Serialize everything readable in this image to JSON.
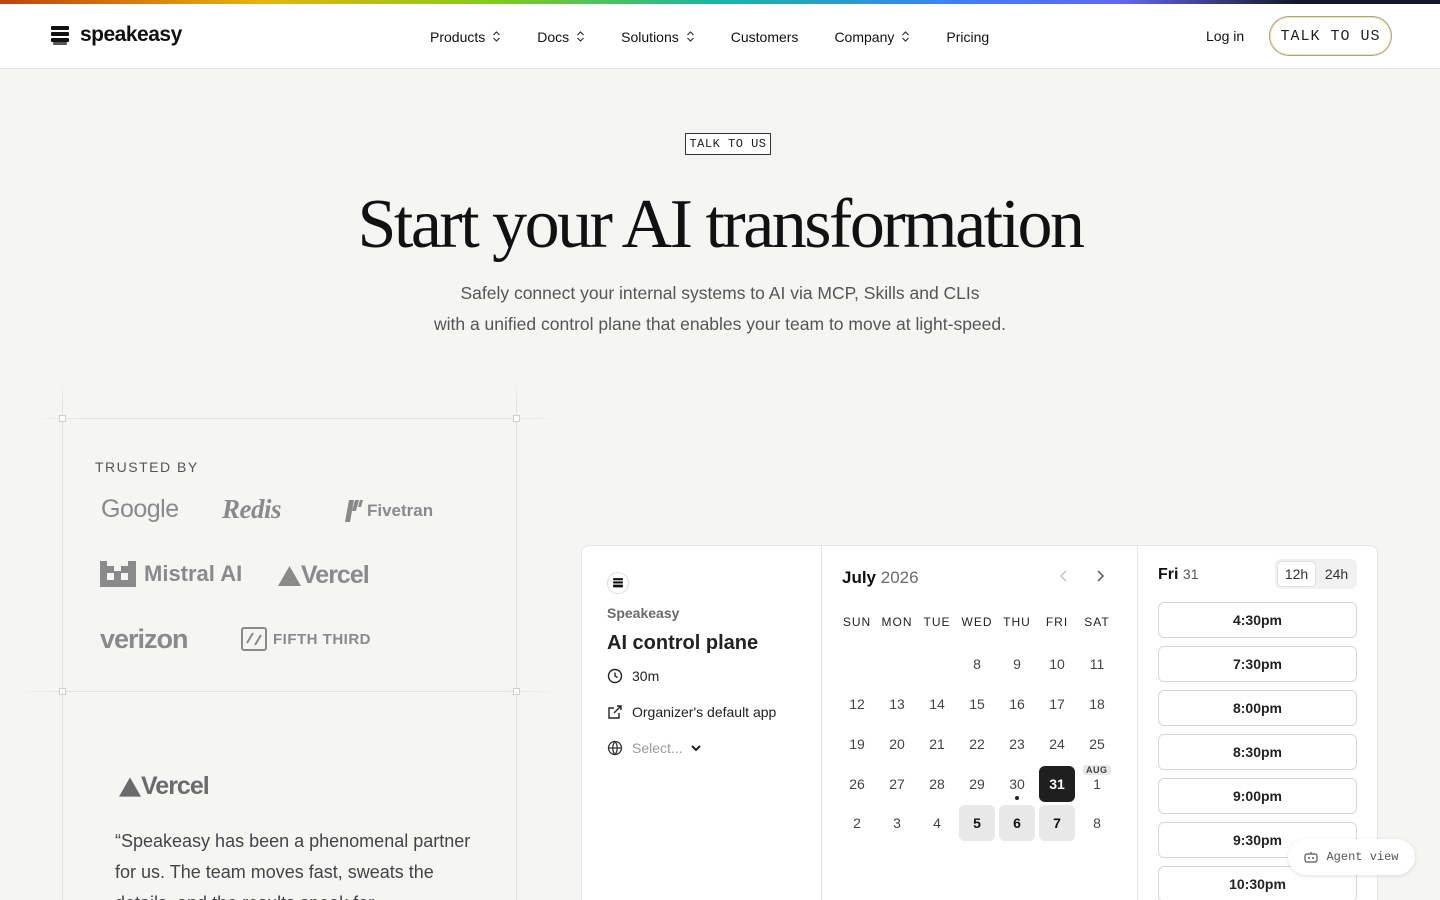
{
  "header": {
    "logo_text": "speakeasy",
    "nav": [
      {
        "label": "Products",
        "has_menu": true
      },
      {
        "label": "Docs",
        "has_menu": true
      },
      {
        "label": "Solutions",
        "has_menu": true
      },
      {
        "label": "Customers",
        "has_menu": false
      },
      {
        "label": "Company",
        "has_menu": true
      },
      {
        "label": "Pricing",
        "has_menu": false
      }
    ],
    "login": "Log in",
    "cta": "TALK TO US"
  },
  "hero": {
    "badge": "TALK TO US",
    "title": "Start your AI transformation",
    "subtitle_line1": "Safely connect your internal systems to AI via MCP, Skills and CLIs",
    "subtitle_line2": "with a unified control plane that enables your team to move at light-speed."
  },
  "trusted": {
    "label": "TRUSTED BY",
    "brands": [
      "Google",
      "Redis",
      "Fivetran",
      "Mistral AI",
      "Vercel",
      "verizon",
      "FIFTH THIRD"
    ]
  },
  "testimonial": {
    "brand": "Vercel",
    "quote": "“Speakeasy has been a phenomenal partner for us. The team moves fast, sweats the details, and the results speak for"
  },
  "booking": {
    "org": "Speakeasy",
    "event_title": "AI control plane",
    "duration": "30m",
    "location": "Organizer's default app",
    "timezone_placeholder": "Select...",
    "month": "July",
    "year": "2026",
    "weekdays": [
      "SUN",
      "MON",
      "TUE",
      "WED",
      "THU",
      "FRI",
      "SAT"
    ],
    "weeks": [
      [
        "",
        "",
        "",
        "8",
        "9",
        "10",
        "11"
      ],
      [
        "12",
        "13",
        "14",
        "15",
        "16",
        "17",
        "18"
      ],
      [
        "19",
        "20",
        "21",
        "22",
        "23",
        "24",
        "25"
      ],
      [
        "26",
        "27",
        "28",
        "29",
        "30",
        "31",
        "1"
      ],
      [
        "2",
        "3",
        "4",
        "5",
        "6",
        "7",
        "8"
      ]
    ],
    "selected_day": "31",
    "today": "30",
    "available_days": [
      "5",
      "6",
      "7"
    ],
    "next_month_tag": "AUG",
    "selected_label": "Fri",
    "selected_num": "31",
    "formats": [
      "12h",
      "24h"
    ],
    "active_format": "12h",
    "slots": [
      "4:30pm",
      "7:30pm",
      "8:00pm",
      "8:30pm",
      "9:00pm",
      "9:30pm",
      "10:30pm"
    ]
  },
  "agent_view": "Agent view"
}
